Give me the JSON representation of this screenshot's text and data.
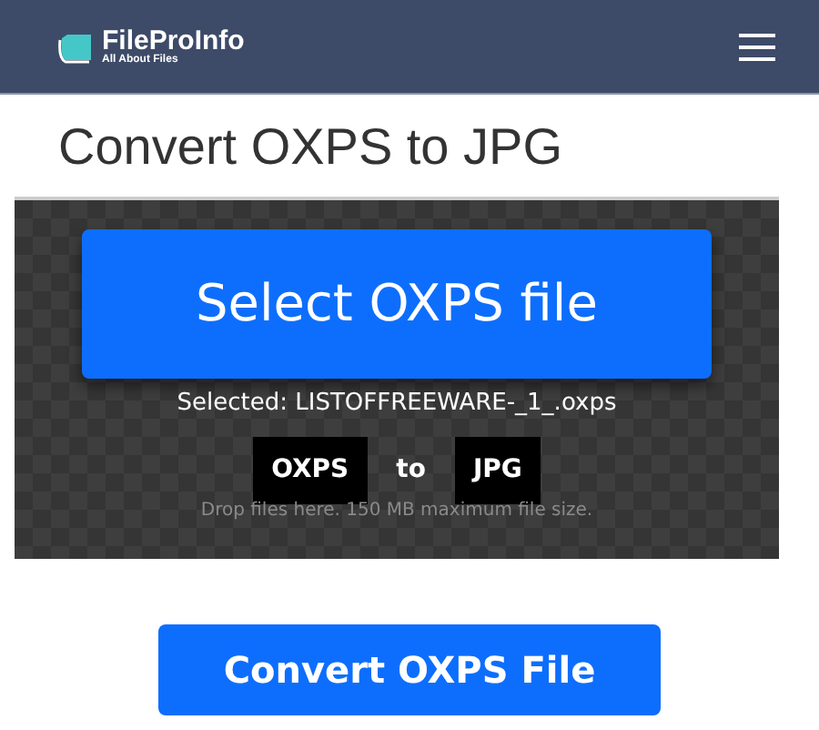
{
  "navbar": {
    "brand": "FileProInfo",
    "tagline": "All About Files"
  },
  "title": "Convert OXPS to JPG",
  "dropzone": {
    "button": "Select OXPS file",
    "selected": "Selected: LISTOFFREEWARE-_1_.oxps",
    "from": "OXPS",
    "joiner": "to",
    "to": "JPG",
    "hint": "Drop files here. 150 MB maximum file size."
  },
  "convert_button": "Convert OXPS File"
}
